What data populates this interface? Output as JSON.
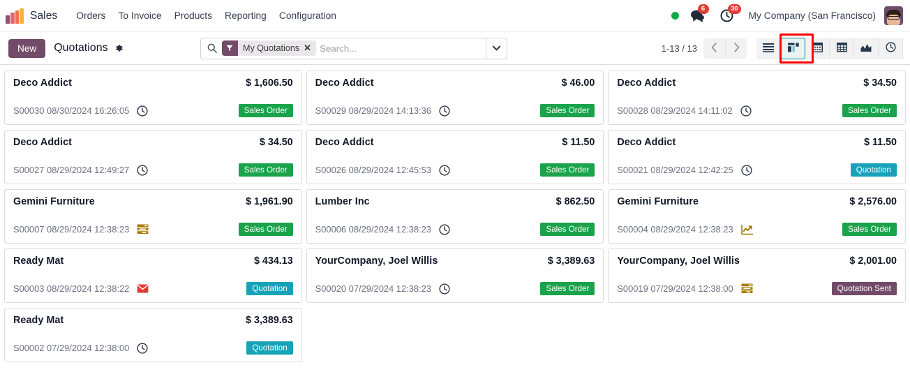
{
  "navbar": {
    "logo_icon": "odoo-bars-logo",
    "app_title": "Sales",
    "menu_items": [
      {
        "label": "Orders",
        "name": "orders"
      },
      {
        "label": "To Invoice",
        "name": "to-invoice"
      },
      {
        "label": "Products",
        "name": "products"
      },
      {
        "label": "Reporting",
        "name": "reporting"
      },
      {
        "label": "Configuration",
        "name": "configuration"
      }
    ],
    "status_dot_color": "#11a84b",
    "messages_icon": "chat-bubble-icon",
    "messages_count": "6",
    "activities_icon": "clock-icon",
    "activities_count": "30",
    "company": "My Company (San Francisco)",
    "avatar_icon": "user-avatar"
  },
  "control_panel": {
    "new_label": "New",
    "breadcrumb": "Quotations",
    "gear_icon": "gear-icon",
    "search": {
      "search_icon": "search-icon",
      "facet_icon": "filter-icon",
      "facet_label": "My Quotations",
      "facet_remove_icon": "close-icon",
      "placeholder": "Search...",
      "value": "",
      "dropdown_icon": "chevron-down-icon"
    },
    "pager": {
      "range": "1-13 / 13",
      "prev_icon": "chevron-left-icon",
      "next_icon": "chevron-right-icon"
    },
    "view_switcher": {
      "active": "kanban",
      "highlighted": "kanban",
      "highlight_color": "#ff0000",
      "active_border_color": "#017e84",
      "views": [
        {
          "name": "list",
          "icon": "list-icon",
          "active": false
        },
        {
          "name": "kanban",
          "icon": "kanban-icon",
          "active": true
        },
        {
          "name": "calendar",
          "icon": "calendar-icon",
          "active": false
        },
        {
          "name": "pivot",
          "icon": "pivot-table-icon",
          "active": false
        },
        {
          "name": "graph",
          "icon": "graph-icon",
          "active": false
        },
        {
          "name": "activity",
          "icon": "activity-clock-icon",
          "active": false
        }
      ]
    }
  },
  "status_colors": {
    "sales_order": "#1aa34a",
    "quotation": "#17a2b8",
    "quotation_sent": "#714b67"
  },
  "kanban": {
    "columns": [
      {
        "cards": [
          {
            "partner": "Deco Addict",
            "amount": "$ 1,606.50",
            "reference": "S00030 08/30/2024 16:26:05",
            "activity_icon": "clock-icon",
            "activity_color": "#2d3748",
            "status": "Sales Order",
            "status_class": "sales-order"
          },
          {
            "partner": "Deco Addict",
            "amount": "$ 34.50",
            "reference": "S00027 08/29/2024 12:49:27",
            "activity_icon": "clock-icon",
            "activity_color": "#2d3748",
            "status": "Sales Order",
            "status_class": "sales-order"
          },
          {
            "partner": "Gemini Furniture",
            "amount": "$ 1,961.90",
            "reference": "S00007 08/29/2024 12:38:23",
            "activity_icon": "upload-document-icon",
            "activity_color": "#a97a00",
            "status": "Sales Order",
            "status_class": "sales-order"
          },
          {
            "partner": "Ready Mat",
            "amount": "$ 434.13",
            "reference": "S00003 08/29/2024 12:38:22",
            "activity_icon": "envelope-icon",
            "activity_color": "#e03c31",
            "status": "Quotation",
            "status_class": "quotation"
          },
          {
            "partner": "Ready Mat",
            "amount": "$ 3,389.63",
            "reference": "S00002 07/29/2024 12:38:00",
            "activity_icon": "clock-icon",
            "activity_color": "#2d3748",
            "status": "Quotation",
            "status_class": "quotation"
          }
        ]
      },
      {
        "cards": [
          {
            "partner": "Deco Addict",
            "amount": "$ 46.00",
            "reference": "S00029 08/29/2024 14:13:36",
            "activity_icon": "clock-icon",
            "activity_color": "#2d3748",
            "status": "Sales Order",
            "status_class": "sales-order"
          },
          {
            "partner": "Deco Addict",
            "amount": "$ 11.50",
            "reference": "S00026 08/29/2024 12:45:53",
            "activity_icon": "clock-icon",
            "activity_color": "#2d3748",
            "status": "Sales Order",
            "status_class": "sales-order"
          },
          {
            "partner": "Lumber Inc",
            "amount": "$ 862.50",
            "reference": "S00006 08/29/2024 12:38:23",
            "activity_icon": "clock-icon",
            "activity_color": "#2d3748",
            "status": "Sales Order",
            "status_class": "sales-order"
          },
          {
            "partner": "YourCompany, Joel Willis",
            "amount": "$ 3,389.63",
            "reference": "S00020 07/29/2024 12:38:23",
            "activity_icon": "clock-icon",
            "activity_color": "#2d3748",
            "status": "Sales Order",
            "status_class": "sales-order"
          }
        ]
      },
      {
        "cards": [
          {
            "partner": "Deco Addict",
            "amount": "$ 34.50",
            "reference": "S00028 08/29/2024 14:11:02",
            "activity_icon": "clock-icon",
            "activity_color": "#2d3748",
            "status": "Sales Order",
            "status_class": "sales-order"
          },
          {
            "partner": "Deco Addict",
            "amount": "$ 11.50",
            "reference": "S00021 08/29/2024 12:42:25",
            "activity_icon": "clock-icon",
            "activity_color": "#2d3748",
            "status": "Quotation",
            "status_class": "quotation"
          },
          {
            "partner": "Gemini Furniture",
            "amount": "$ 2,576.00",
            "reference": "S00004 08/29/2024 12:38:23",
            "activity_icon": "chart-line-icon",
            "activity_color": "#a97a00",
            "status": "Sales Order",
            "status_class": "sales-order"
          },
          {
            "partner": "YourCompany, Joel Willis",
            "amount": "$ 2,001.00",
            "reference": "S00019 07/29/2024 12:38:00",
            "activity_icon": "upload-document-icon",
            "activity_color": "#a97a00",
            "status": "Quotation Sent",
            "status_class": "quotation-sent"
          }
        ]
      }
    ]
  }
}
